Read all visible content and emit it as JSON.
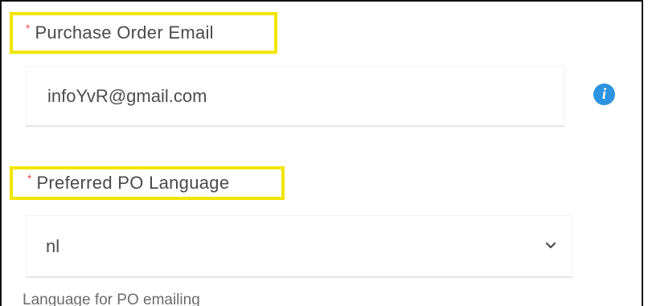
{
  "form": {
    "po_email": {
      "required_marker": "*",
      "label": "Purchase Order Email",
      "value": "infoYvR@gmail.com"
    },
    "po_language": {
      "required_marker": "*",
      "label": "Preferred PO Language",
      "selected_value": "nl",
      "help_text": "Language for PO emailing"
    },
    "icons": {
      "info": "info-icon",
      "info_glyph": "i",
      "dropdown": "chevron-down-icon"
    },
    "colors": {
      "highlight_border": "#f2e600",
      "required": "#e84a4a",
      "info": "#2e93e0"
    }
  }
}
